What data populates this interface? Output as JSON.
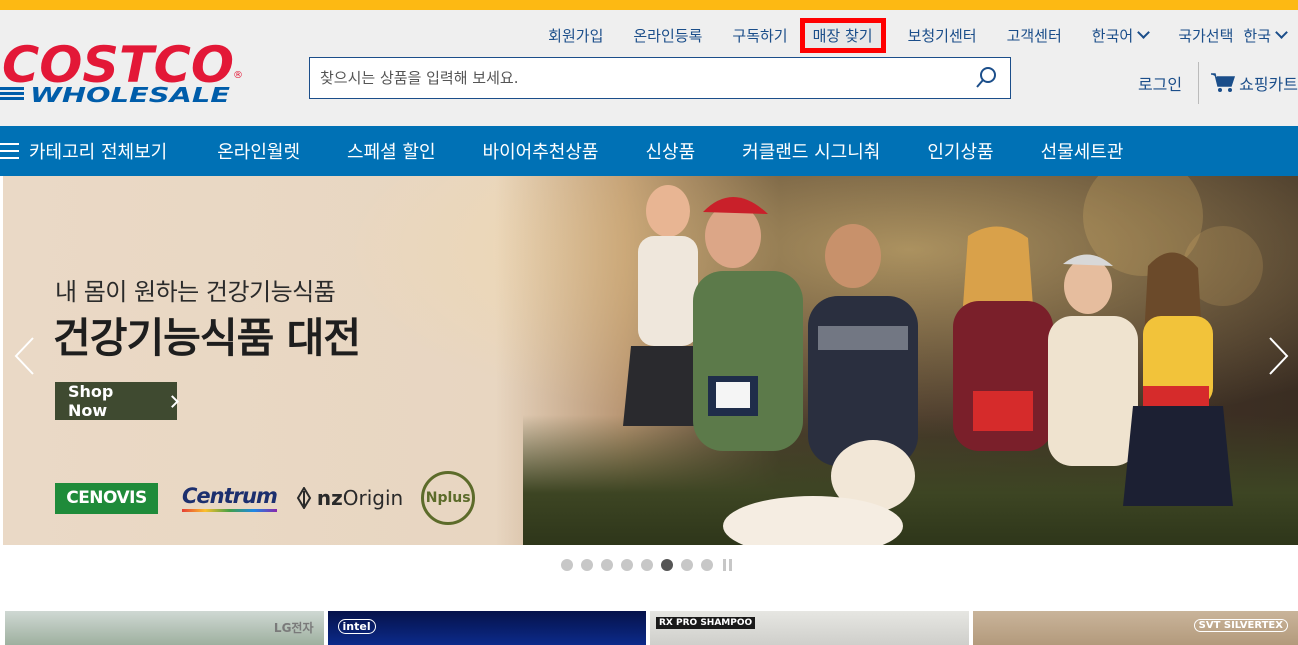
{
  "utility_nav": {
    "items": [
      "회원가입",
      "온라인등록",
      "구독하기",
      "매장 찾기",
      "보청기센터",
      "고객센터"
    ],
    "language": "한국어",
    "country_label": "국가선택",
    "country_value": "한국"
  },
  "logo": {
    "line1": "COSTCO",
    "line2": "WHOLESALE",
    "registered": "®"
  },
  "search": {
    "placeholder": "찾으시는 상품을 입력해 보세요.",
    "value": ""
  },
  "account": {
    "login": "로그인",
    "cart": "쇼핑카트"
  },
  "main_nav": {
    "all_categories": "카테고리 전체보기",
    "items": [
      "온라인월렛",
      "스페셜 할인",
      "바이어추천상품",
      "신상품",
      "커클랜드 시그니춰",
      "인기상품",
      "선물세트관"
    ]
  },
  "hero": {
    "subtitle": "내 몸이 원하는 건강기능식품",
    "title": "건강기능식품 대전",
    "cta": "Shop Now",
    "brands": [
      "CENOVIS",
      "Centrum",
      "nzOrigin",
      "Nplus"
    ],
    "brand_nz_prefix": "nz",
    "brand_nz_suffix": "Origin"
  },
  "carousel": {
    "slide_count": 8,
    "active_index": 6
  },
  "tiles": [
    "LG전자",
    "intel",
    "RX PRO SHAMPOO",
    "SVT SILVERTEX"
  ],
  "colors": {
    "accent_yellow": "#fdb913",
    "nav_blue": "#0071b5",
    "logo_red": "#e31837",
    "logo_blue": "#005daa",
    "highlight_red": "#ff0000"
  }
}
